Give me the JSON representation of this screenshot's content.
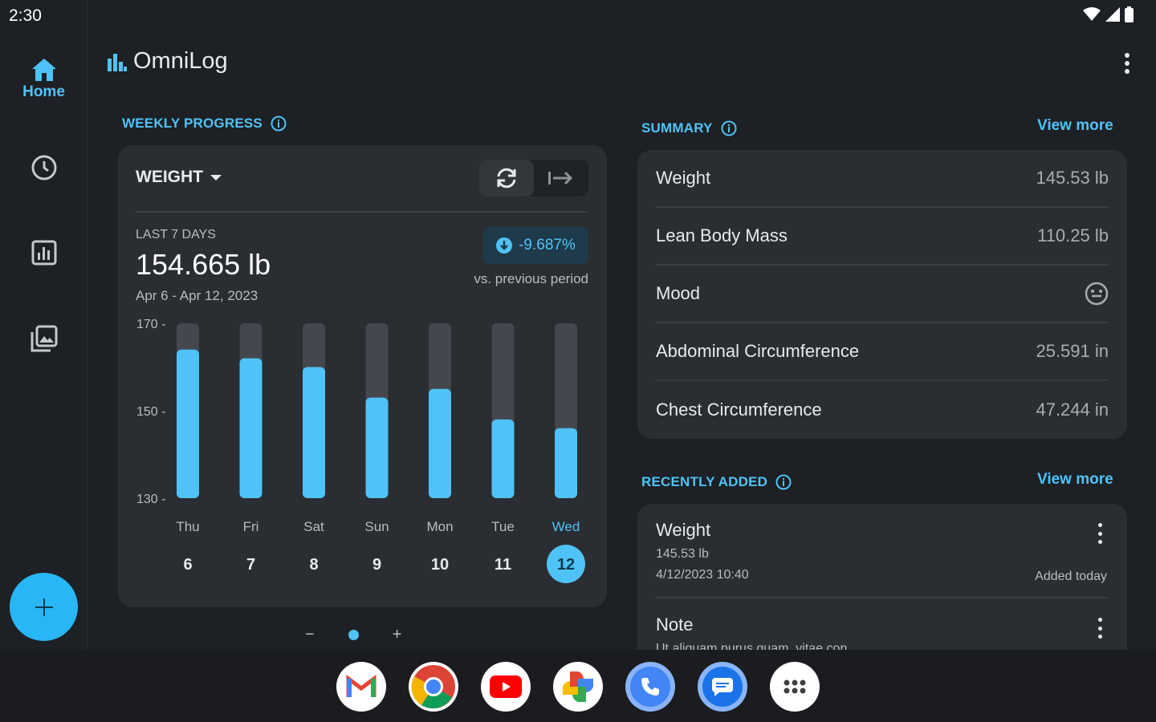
{
  "status_bar": {
    "time": "2:30"
  },
  "nav": {
    "items": [
      {
        "label": "Home",
        "icon": "home-icon",
        "active": true
      },
      {
        "label": "",
        "icon": "history-icon"
      },
      {
        "label": "",
        "icon": "chart-icon"
      },
      {
        "label": "",
        "icon": "gallery-icon"
      }
    ],
    "fab_icon": "plus"
  },
  "header": {
    "title": "OmniLog"
  },
  "weekly": {
    "section_label": "WEEKLY PROGRESS",
    "metric": "WEIGHT",
    "range_label": "LAST 7 DAYS",
    "value": "154.665 lb",
    "dates": "Apr 6 - Apr 12, 2023",
    "delta": "-9.687%",
    "delta_sub": "vs. previous period"
  },
  "chart_data": {
    "type": "bar",
    "categories": [
      "Thu",
      "Fri",
      "Sat",
      "Sun",
      "Mon",
      "Tue",
      "Wed"
    ],
    "day_numbers": [
      "6",
      "7",
      "8",
      "9",
      "10",
      "11",
      "12"
    ],
    "values": [
      164,
      162,
      160,
      153,
      155,
      148,
      146
    ],
    "ylim": [
      130,
      170
    ],
    "yticks": [
      "170",
      "150",
      "130"
    ],
    "highlight_index": 6,
    "colors": {
      "bar": "#4fc3f7",
      "track": "#44484e"
    }
  },
  "pager": {
    "minus": "−",
    "plus": "+"
  },
  "summary": {
    "section_label": "SUMMARY",
    "view_more": "View more",
    "rows": [
      {
        "name": "Weight",
        "value": "145.53 lb"
      },
      {
        "name": "Lean Body Mass",
        "value": "110.25 lb"
      },
      {
        "name": "Mood",
        "value": ""
      },
      {
        "name": "Abdominal Circumference",
        "value": "25.591 in"
      },
      {
        "name": "Chest Circumference",
        "value": "47.244 in"
      }
    ]
  },
  "recent": {
    "section_label": "RECENTLY ADDED",
    "view_more": "View more",
    "items": [
      {
        "title": "Weight",
        "line1": "145.53 lb",
        "line2": "4/12/2023 10:40",
        "added": "Added today"
      },
      {
        "title": "Note",
        "line1": "Ut aliquam purus quam, vitae con",
        "line2": "",
        "added": ""
      }
    ]
  },
  "dock": {
    "apps": [
      "gmail-icon",
      "chrome-icon",
      "youtube-icon",
      "photos-icon",
      "phone-icon",
      "messages-icon",
      "app-drawer-icon"
    ]
  }
}
